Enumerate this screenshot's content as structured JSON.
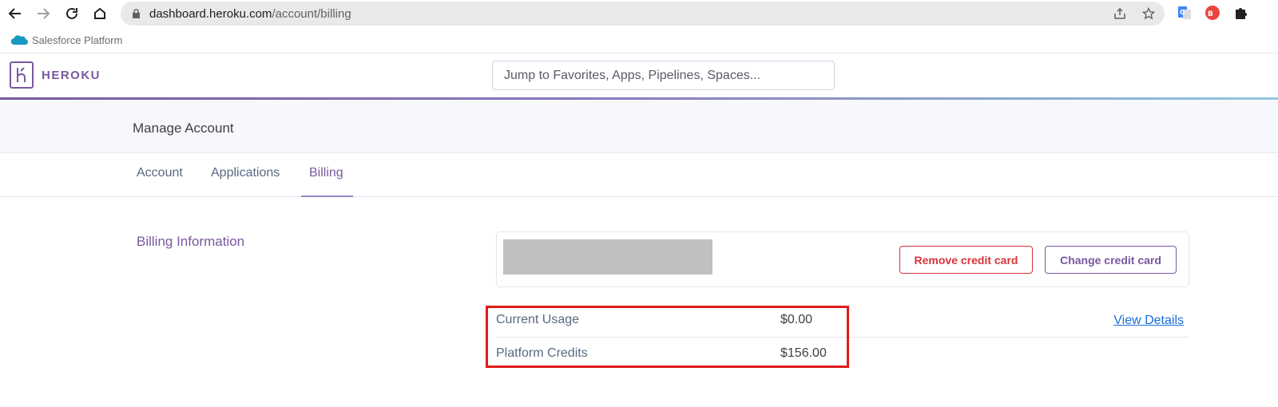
{
  "browser": {
    "url_host": "dashboard.heroku.com",
    "url_path": "/account/billing",
    "icons": [
      "back-icon",
      "forward-icon",
      "reload-icon",
      "home-icon",
      "lock-icon",
      "share-icon",
      "star-icon",
      "translate-extension-icon",
      "red-extension-icon",
      "puzzle-icon"
    ]
  },
  "salesforce": {
    "label": "Salesforce Platform"
  },
  "header": {
    "logo_text": "HEROKU",
    "search_placeholder": "Jump to Favorites, Apps, Pipelines, Spaces..."
  },
  "manage": {
    "title": "Manage Account"
  },
  "tabs": [
    {
      "label": "Account",
      "active": false
    },
    {
      "label": "Applications",
      "active": false
    },
    {
      "label": "Billing",
      "active": true
    }
  ],
  "billing": {
    "section_title": "Billing Information",
    "remove_label": "Remove credit card",
    "change_label": "Change credit card",
    "rows": [
      {
        "label": "Current Usage",
        "value": "$0.00"
      },
      {
        "label": "Platform Credits",
        "value": "$156.00"
      }
    ],
    "view_details": "View Details"
  },
  "colors": {
    "brand": "#79589f",
    "danger": "#d8323b",
    "link": "#1a6dd8",
    "highlight": "#e01b1b"
  }
}
